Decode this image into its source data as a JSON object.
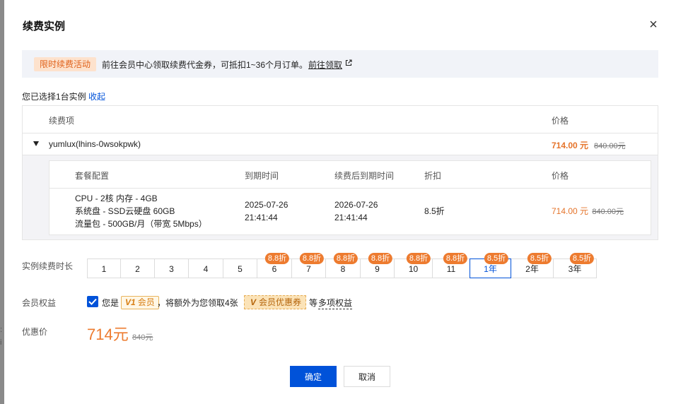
{
  "dialog": {
    "title": "续费实例",
    "close_icon": "×"
  },
  "promo": {
    "tag": "限时续费活动",
    "text": "前往会员中心领取续费代金券，可抵扣1~36个月订单。",
    "link": "前往领取"
  },
  "selection": {
    "info": "您已选择1台实例",
    "collapse": "收起"
  },
  "renew_table": {
    "headers": {
      "item": "续费项",
      "price": "价格"
    },
    "instance": {
      "name": "yumlux(lhins-0wsokpwk)",
      "price": "714.00 元",
      "original_price": "840.00元"
    },
    "detail_headers": {
      "config": "套餐配置",
      "expire": "到期时间",
      "renew_expire": "续费后到期时间",
      "discount": "折扣",
      "price": "价格"
    },
    "detail_row": {
      "config_lines": [
        "CPU - 2核 内存 - 4GB",
        "系统盘 - SSD云硬盘 60GB",
        "流量包 - 500GB/月（带宽 5Mbps）"
      ],
      "expire_date": "2025-07-26",
      "expire_time": "21:41:44",
      "renew_date": "2026-07-26",
      "renew_time": "21:41:44",
      "discount": "8.5折",
      "price": "714.00 元",
      "original_price": "840.00元"
    }
  },
  "duration": {
    "label": "实例续费时长",
    "options": [
      {
        "label": "1",
        "badge": ""
      },
      {
        "label": "2",
        "badge": ""
      },
      {
        "label": "3",
        "badge": ""
      },
      {
        "label": "4",
        "badge": ""
      },
      {
        "label": "5",
        "badge": ""
      },
      {
        "label": "6",
        "badge": "8.8折"
      },
      {
        "label": "7",
        "badge": "8.8折"
      },
      {
        "label": "8",
        "badge": "8.8折"
      },
      {
        "label": "9",
        "badge": "8.8折"
      },
      {
        "label": "10",
        "badge": "8.8折"
      },
      {
        "label": "11",
        "badge": "8.8折"
      },
      {
        "label": "1年",
        "badge": "8.5折",
        "selected": true
      },
      {
        "label": "2年",
        "badge": "8.5折"
      },
      {
        "label": "3年",
        "badge": "8.5折"
      }
    ]
  },
  "member": {
    "label": "会员权益",
    "text_you": "您是",
    "level_mark": "V1",
    "level_text": "会员",
    "text_extra": "，将额外为您领取4张",
    "coupon_mark": "V",
    "coupon_text": "会员优惠券",
    "text_etc": "等",
    "more_link": "多项权益",
    "checked": true
  },
  "final": {
    "label": "优惠价",
    "price": "714元",
    "original_price": "840元"
  },
  "buttons": {
    "ok": "确定",
    "cancel": "取消"
  },
  "colors": {
    "primary": "#0052d9",
    "accent_orange": "#ed7b2f",
    "promo_tag_bg": "#fde2cd"
  }
}
